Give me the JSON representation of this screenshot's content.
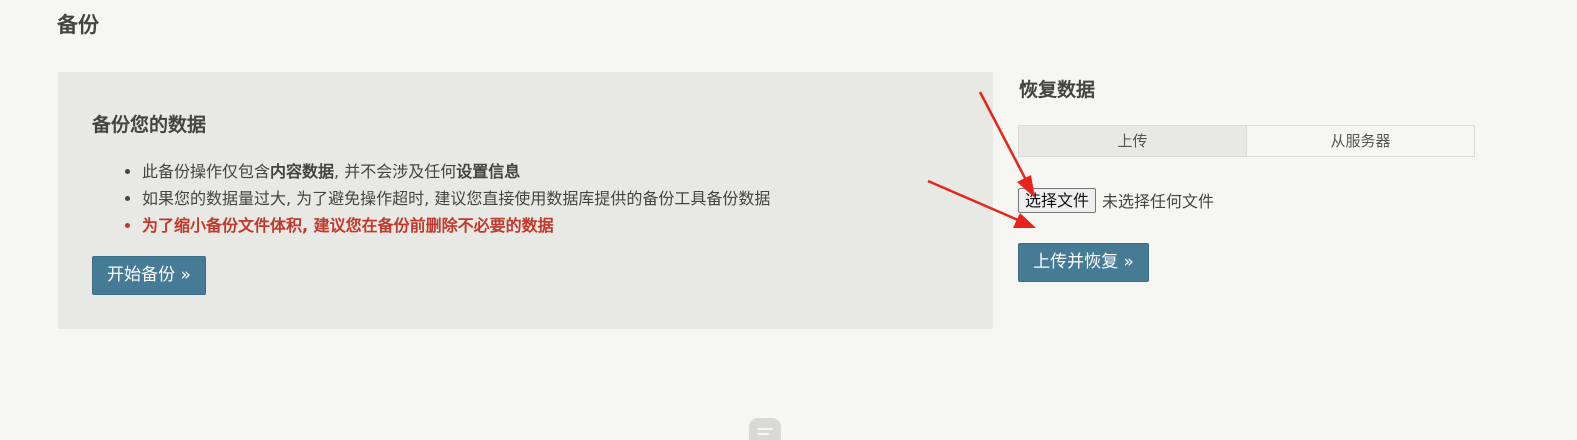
{
  "page": {
    "title": "备份"
  },
  "backup": {
    "heading": "备份您的数据",
    "items": [
      {
        "pre": "此备份操作仅包含",
        "bold1": "内容数据",
        "mid": ", 并不会涉及任何",
        "bold2": "设置信息"
      },
      {
        "text": "如果您的数据量过大, 为了避免操作超时, 建议您直接使用数据库提供的备份工具备份数据"
      },
      {
        "text": "为了缩小备份文件体积, 建议您在备份前删除不必要的数据"
      }
    ],
    "start_button": "开始备份 »"
  },
  "restore": {
    "title": "恢复数据",
    "tabs": [
      {
        "label": "上传",
        "active": true
      },
      {
        "label": "从服务器",
        "active": false
      }
    ],
    "file_button": "选择文件",
    "file_status": "未选择任何文件",
    "submit_button": "上传并恢复 »"
  },
  "colors": {
    "primary_button": "#467b96",
    "warning_text": "#c0392b",
    "annotation_arrow": "#e8231a"
  }
}
